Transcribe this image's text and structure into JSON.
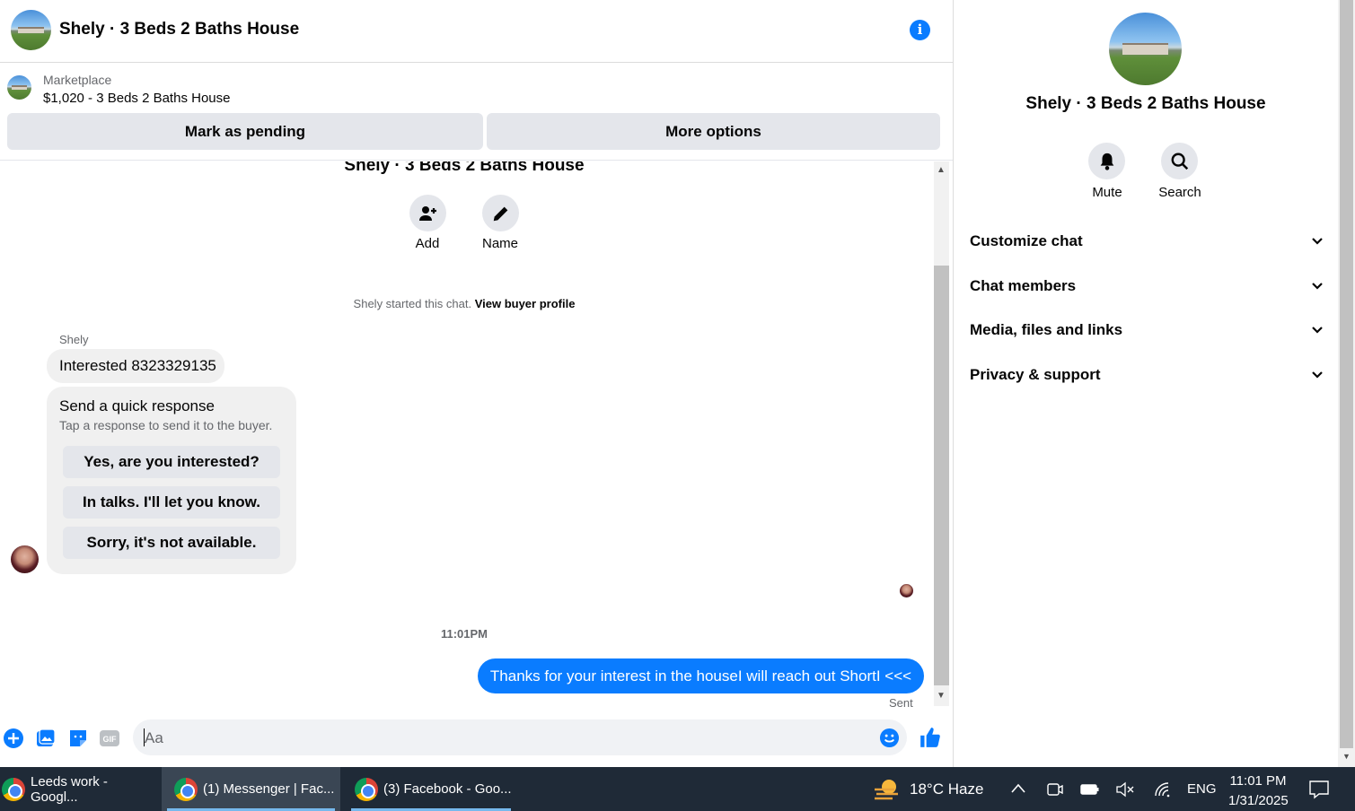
{
  "header": {
    "title": "Shely · 3 Beds 2 Baths House"
  },
  "listing": {
    "source": "Marketplace",
    "price_title": "$1,020 - 3 Beds 2 Baths House",
    "mark_pending": "Mark as pending",
    "more_options": "More options"
  },
  "conversation": {
    "title": "Shely · 3 Beds 2 Baths House",
    "add_label": "Add",
    "name_label": "Name",
    "started_text": "Shely started this chat.",
    "view_profile": "View buyer profile",
    "sender": "Shely",
    "message1": "Interested 8323329135",
    "quick_title": "Send a quick response",
    "quick_subtitle": "Tap a response to send it to the buyer.",
    "quick_replies": [
      "Yes, are you interested?",
      "In talks. I'll let you know.",
      "Sorry, it's not available."
    ],
    "timestamp": "11:01PM",
    "outgoing": "Thanks for your interest in the houseI will reach out ShortI <<<",
    "status": "Sent"
  },
  "composer": {
    "placeholder": "Aa"
  },
  "right_panel": {
    "title": "Shely · 3 Beds 2 Baths House",
    "mute_label": "Mute",
    "search_label": "Search",
    "sections": [
      "Customize chat",
      "Chat members",
      "Media, files and links",
      "Privacy & support"
    ]
  },
  "taskbar": {
    "items": [
      "Leeds work - Googl...",
      "(1) Messenger | Fac...",
      "(3) Facebook - Goo..."
    ],
    "weather": "18°C  Haze",
    "lang": "ENG",
    "time": "11:01 PM",
    "date": "1/31/2025"
  },
  "colors": {
    "accent": "#0a7cff",
    "button_grey": "#e4e6eb",
    "taskbar": "#1f2a37"
  },
  "icons": [
    "info-icon",
    "add-person-icon",
    "pencil-icon",
    "bell-icon",
    "search-icon",
    "chevron-down-icon",
    "plus-icon",
    "photo-icon",
    "sticker-icon",
    "gif-icon",
    "emoji-icon",
    "like-icon"
  ]
}
